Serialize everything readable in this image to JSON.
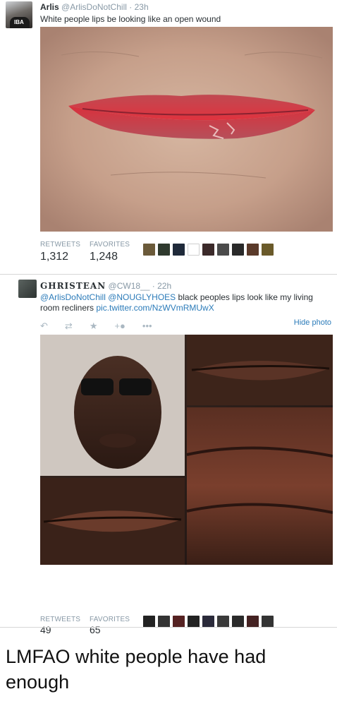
{
  "tweet1": {
    "author_name": "Arlis",
    "author_handle": "@ArlisDoNotChill",
    "separator": "·",
    "time": "23h",
    "text": "White people lips be looking like an open wound",
    "avatar_cap_text": "IBA",
    "stats": {
      "retweets_label": "RETWEETS",
      "retweets_value": "1,312",
      "favorites_label": "FAVORITES",
      "favorites_value": "1,248"
    }
  },
  "tweet2": {
    "author_name": "GHRISTEAN",
    "author_handle": "@CW18__",
    "separator": "·",
    "time": "22h",
    "text_mentions": "@ArlisDoNotChill @NOUGLYHOES",
    "text_body": " black peoples lips look like my living room recliners ",
    "text_link": "pic.twitter.com/NzWVmRMUwX",
    "actions": {
      "reply_icon": "reply-icon",
      "retweet_icon": "retweet-icon",
      "favorite_icon": "star-icon",
      "follow_icon": "follow-icon",
      "more_icon": "more-icon"
    },
    "hide_photo_label": "Hide photo",
    "stats": {
      "retweets_label": "RETWEETS",
      "retweets_value": "49",
      "favorites_label": "FAVORITES",
      "favorites_value": "65"
    }
  },
  "caption": "LMFAO white people have had enough",
  "colors": {
    "link": "#2b7bb9",
    "muted": "#8899a6",
    "text": "#292f33",
    "divider": "#d6d6d6"
  }
}
